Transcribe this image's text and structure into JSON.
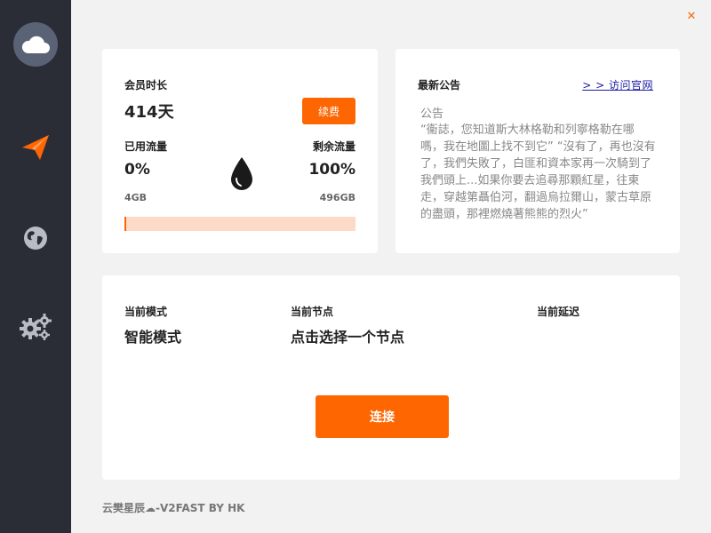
{
  "window": {
    "close_glyph": "✕",
    "accent": "#fe6602",
    "sidebar_bg": "#2b2d36"
  },
  "sidebar": {
    "items": [
      {
        "icon": "paper-plane-icon",
        "active": true
      },
      {
        "icon": "globe-icon",
        "active": false
      },
      {
        "icon": "gears-icon",
        "active": false
      }
    ]
  },
  "membership": {
    "duration_label": "会员时长",
    "duration_value": "414天",
    "renew_label": "续费",
    "used_label": "已用流量",
    "used_percent": "0%",
    "used_amount": "4GB",
    "remaining_label": "剩余流量",
    "remaining_percent": "100%",
    "remaining_amount": "496GB",
    "usage_fraction": 0.008
  },
  "notice": {
    "title": "最新公告",
    "link_label": "> > 访问官网",
    "subtitle": "公告",
    "body": "“衞誌，您知道斯大林格勒和列寧格勒在哪嗎，我在地圖上找不到它” “沒有了，再也沒有了，我們失敗了，白匪和資本家再一次騎到了我們頭上...如果你要去追尋那顆紅星，往東走，穿越第聶伯河，翻過烏拉爾山，蒙古草原的盡頭，那裡燃燒著熊熊的烈火”"
  },
  "connection": {
    "mode_label": "当前模式",
    "mode_value": "智能模式",
    "node_label": "当前节点",
    "node_value": "点击选择一个节点",
    "latency_label": "当前延迟",
    "connect_label": "连接"
  },
  "footer": {
    "text": "云樊星辰☁-V2FAST BY HK"
  }
}
